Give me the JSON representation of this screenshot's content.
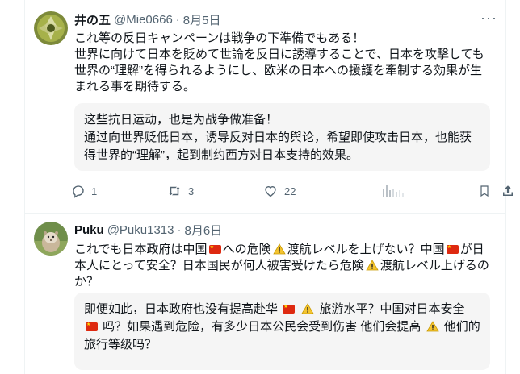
{
  "tweets": [
    {
      "name": "井の五",
      "handle": "@Mie0666",
      "separator": "·",
      "date": "8月5日",
      "more_label": "···",
      "text_lines": [
        "これ等の反日キャンペーンは戦争の下準備でもある！",
        "世界に向けて日本を貶めて世論を反日に誘導することで、日本を攻撃しても",
        "世界の“理解”を得られるようにし、欧米の日本への援護を牽制する効果が生",
        "まれる事を期待する。"
      ],
      "translation_lines": [
        "这些抗日运动，也是为战争做准备！",
        "通过向世界贬低日本，诱导反对日本的舆论，希望即使攻击日本，也能获",
        "得世界的“理解”，起到制约西方对日本支持的效果。"
      ],
      "actions": {
        "replies": "1",
        "reposts": "3",
        "likes": "22"
      }
    },
    {
      "name": "Puku",
      "handle": "@Puku1313",
      "separator": "·",
      "date": "8月6日",
      "text": {
        "l1_a": "これでも日本政府は中国",
        "l1_b": "への危険",
        "l1_c": "渡航レベルを上げない？中国",
        "l1_d": "が日",
        "l2_a": "本人にとって安全？日本国民が何人被害受けたら危険",
        "l2_b": "渡航レベル上げるの",
        "l3": "か？"
      },
      "translation": {
        "l1_a": "即便如此，日本政府也没有提高赴华",
        "l1_b": "旅游水平？中国对日本安全",
        "l2_a": "吗？如果遇到危险，有多少日本公民会受到伤害 他们会提高",
        "l2_b": "他们的",
        "l3": "旅行等级吗？"
      }
    }
  ],
  "colors": {
    "text": "#0f1419",
    "secondary": "#536471",
    "translation_bg": "#f5f5f5",
    "divider": "#eff3f4",
    "flag_red": "#de2910",
    "flag_star": "#ffde00",
    "warning_yellow": "#f4c430"
  },
  "icons": [
    "reply-icon",
    "repost-icon",
    "like-icon",
    "views-icon",
    "bookmark-icon",
    "share-icon",
    "flag-cn-icon",
    "warning-icon"
  ]
}
